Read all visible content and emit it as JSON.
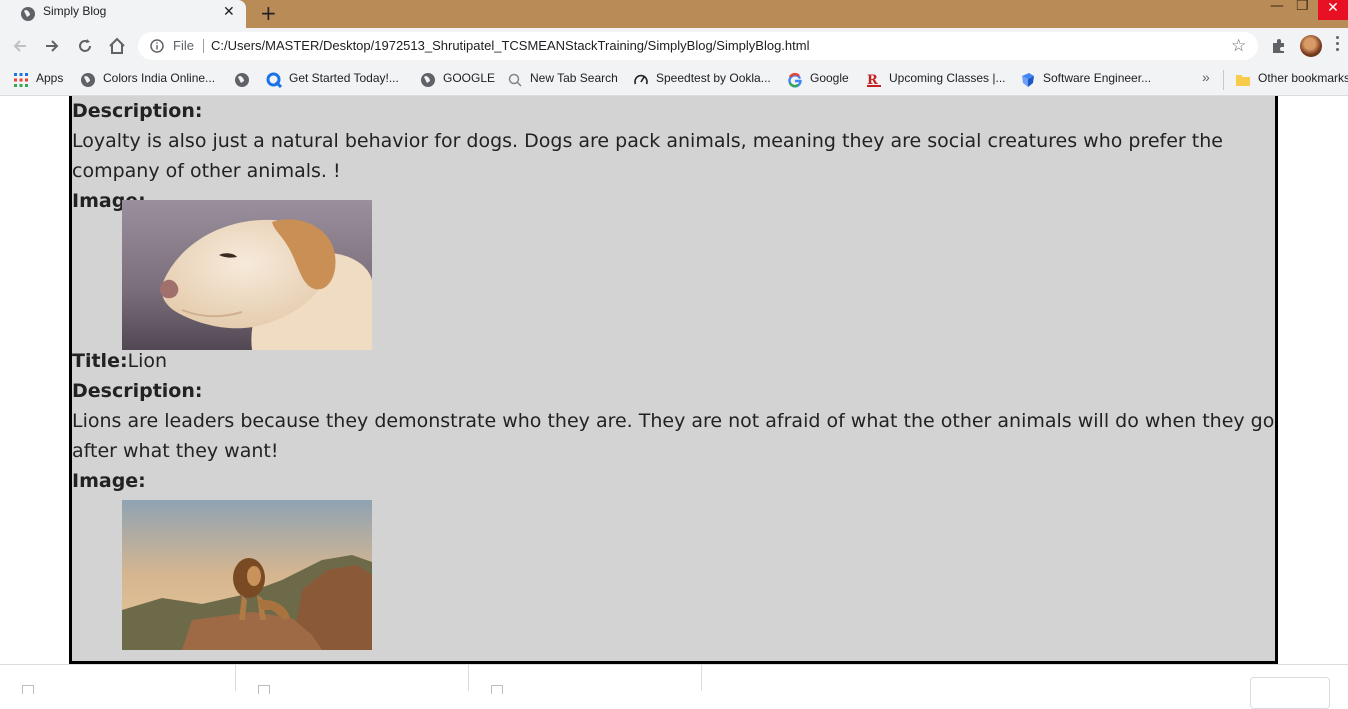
{
  "browser": {
    "tab": {
      "title": "Simply Blog",
      "close": "✕"
    },
    "new_tab": "+",
    "window": {
      "minimize": "—",
      "restore": "❐",
      "close": "✕"
    },
    "omnibox": {
      "scheme": "File",
      "url": "C:/Users/MASTER/Desktop/1972513_Shrutipatel_TCSMEANStackTraining/SimplyBlog/SimplyBlog.html"
    },
    "star": "☆",
    "bookmarks": [
      {
        "label": "Apps",
        "icon": "apps-grid-icon"
      },
      {
        "label": "Colors India Online...",
        "icon": "globe-icon"
      },
      {
        "label": "",
        "icon": "globe-icon"
      },
      {
        "label": "Get Started Today!...",
        "icon": "q-logo-icon"
      },
      {
        "label": "GOOGLE",
        "icon": "globe-icon"
      },
      {
        "label": "New Tab Search",
        "icon": "search-icon"
      },
      {
        "label": "Speedtest by Ookla...",
        "icon": "speedometer-icon"
      },
      {
        "label": "Google",
        "icon": "google-g-icon"
      },
      {
        "label": "Upcoming Classes |...",
        "icon": "r-business-icon"
      },
      {
        "label": "Software Engineer...",
        "icon": "bookmark-blue-icon"
      }
    ],
    "more": "»",
    "other_bookmarks": "Other bookmarks"
  },
  "page": {
    "posts": [
      {
        "description_label": "Description:",
        "description": "Loyalty is also just a natural behavior for dogs. Dogs are pack animals, meaning they are social creatures who prefer the company of other animals. !",
        "image_label": "Image:",
        "image_subject": "dog"
      },
      {
        "title_label": "Title:",
        "title": "Lion",
        "description_label": "Description:",
        "description": "Lions are leaders because they demonstrate who they are. They are not afraid of what the other animals will do when they go after what they want!",
        "image_label": "Image:",
        "image_subject": "lion"
      }
    ]
  },
  "colors": {
    "tabstrip": "#b98b57",
    "toolbar": "#f1f3f4",
    "card_bg": "#d3d3d3",
    "card_border": "#000000"
  }
}
